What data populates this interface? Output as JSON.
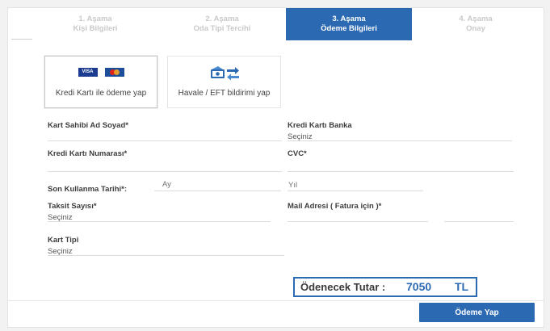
{
  "steps": [
    {
      "line1": "1. Aşama",
      "line2": "Kişi Bilgileri"
    },
    {
      "line1": "2. Aşama",
      "line2": "Oda Tipi Tercihi"
    },
    {
      "line1": "3. Aşama",
      "line2": "Ödeme Bilgileri"
    },
    {
      "line1": "4. Aşama",
      "line2": "Onay"
    }
  ],
  "active_step": 3,
  "payment_methods": {
    "card": {
      "label": "Kredi Kartı ile ödeme yap",
      "visa_text": "VISA"
    },
    "eft": {
      "label": "Havale / EFT bildirimi yap"
    }
  },
  "form": {
    "card_holder": {
      "label": "Kart Sahibi Ad Soyad*",
      "value": ""
    },
    "card_bank": {
      "label": "Kredi Kartı Banka",
      "value": "Seçiniz"
    },
    "card_number": {
      "label": "Kredi Kartı Numarası*",
      "value": ""
    },
    "cvc": {
      "label": "CVC*",
      "value": ""
    },
    "expiry": {
      "label": "Son Kullanma Tarihi*:",
      "month_placeholder": "Ay",
      "year_placeholder": "Yıl"
    },
    "installments": {
      "label": "Taksit Sayısı*",
      "value": "Seçiniz"
    },
    "mail": {
      "label": "Mail Adresi ( Fatura için )*",
      "value": ""
    },
    "card_type": {
      "label": "Kart Tipi",
      "value": "Seçiniz"
    }
  },
  "total": {
    "label": "Ödenecek Tutar :",
    "amount": "7050",
    "currency": "TL"
  },
  "pay_button": "Ödeme Yap",
  "colors": {
    "accent": "#2b69b3",
    "inactive_step_text": "#c9c9c9"
  }
}
